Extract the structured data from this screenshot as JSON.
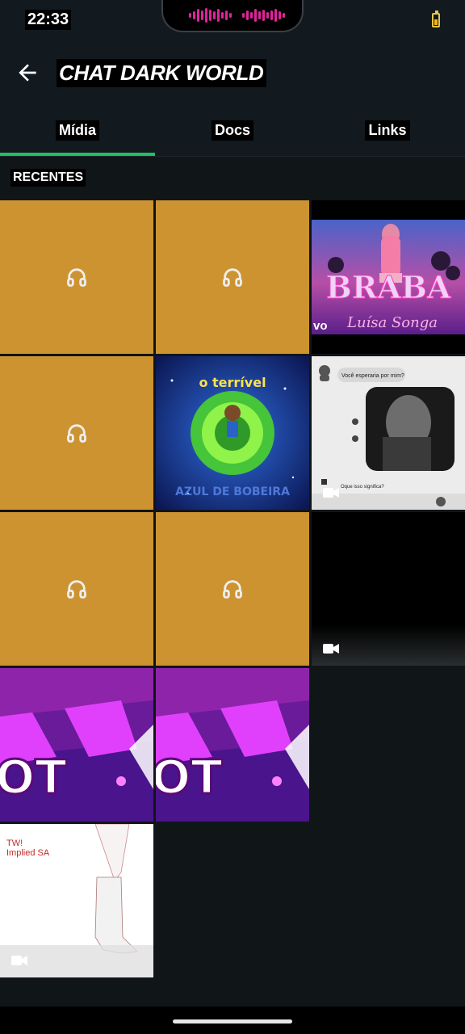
{
  "status_bar": {
    "time": "22:33"
  },
  "header": {
    "title": "CHAT DARK WORLD"
  },
  "tabs": [
    {
      "label": "Mídia",
      "selected": true
    },
    {
      "label": "Docs",
      "selected": false
    },
    {
      "label": "Links",
      "selected": false
    }
  ],
  "section": {
    "label": "RECENTES"
  },
  "media": {
    "brabo_title": "BRABA",
    "brabo_artist": "Luísa Songa",
    "brabo_vevo": "vo",
    "terrivel_title": "o terrível",
    "terrivel_sub": "AZUL DE BOBEIRA",
    "chat_question": "Você esperaria por mim?",
    "chat_reply": "Oque isso significa?",
    "bot_text": "OT",
    "tw_line1": "TW!",
    "tw_line2": "Implied SA"
  },
  "colors": {
    "accent": "#21c063",
    "audio_tile": "#cd9331",
    "background": "#101518"
  }
}
